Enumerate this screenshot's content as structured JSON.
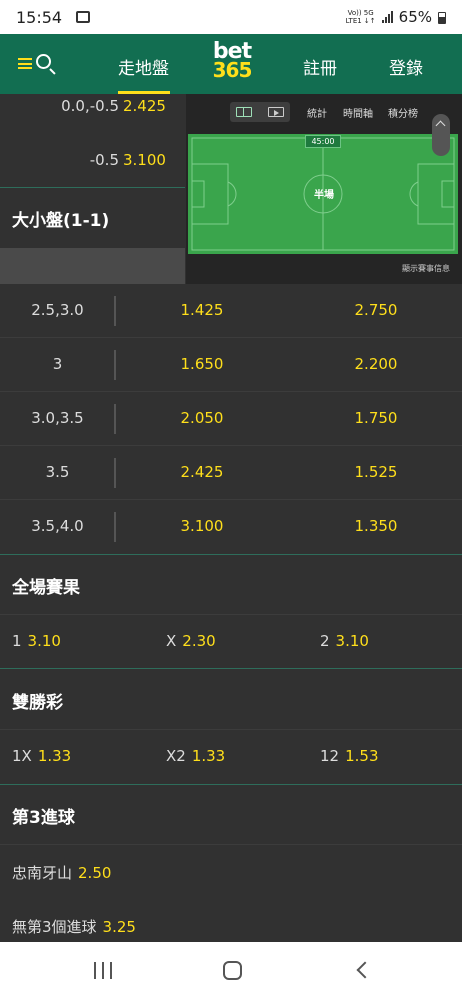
{
  "status_bar": {
    "time": "15:54",
    "network_top": "Vo)) 5G",
    "network_bottom": "LTE1 ↓↑",
    "battery": "65%"
  },
  "header": {
    "tabs": [
      {
        "label": "走地盤",
        "active": true
      },
      {
        "label": "註冊"
      },
      {
        "label": "登錄"
      }
    ],
    "logo_top": "bet",
    "logo_bottom": "365",
    "brand_color": "#126e51",
    "accent_color": "#ffdf1b"
  },
  "handicap": [
    {
      "line": "0.0,-0.5",
      "odds": "2.425"
    },
    {
      "line": "-0.5",
      "odds": "3.100"
    }
  ],
  "match_panel": {
    "tabs": [
      "統計",
      "時間軸",
      "積分榜"
    ],
    "clock": "45:00",
    "period": "半場",
    "info_link": "顯示賽事信息"
  },
  "over_under": {
    "title": "大小盤(1-1)",
    "rows": [
      {
        "line": "2.5,3.0",
        "over": "1.425",
        "under": "2.750"
      },
      {
        "line": "3",
        "over": "1.650",
        "under": "2.200"
      },
      {
        "line": "3.0,3.5",
        "over": "2.050",
        "under": "1.750"
      },
      {
        "line": "3.5",
        "over": "2.425",
        "under": "1.525"
      },
      {
        "line": "3.5,4.0",
        "over": "3.100",
        "under": "1.350"
      }
    ]
  },
  "full_time_result": {
    "title": "全場賽果",
    "selections": [
      {
        "name": "1",
        "odds": "3.10"
      },
      {
        "name": "X",
        "odds": "2.30"
      },
      {
        "name": "2",
        "odds": "3.10"
      }
    ]
  },
  "double_chance": {
    "title": "雙勝彩",
    "selections": [
      {
        "name": "1X",
        "odds": "1.33"
      },
      {
        "name": "X2",
        "odds": "1.33"
      },
      {
        "name": "12",
        "odds": "1.53"
      }
    ]
  },
  "third_goal": {
    "title": "第3進球",
    "selections": [
      {
        "name": "忠南牙山",
        "odds": "2.50"
      },
      {
        "name": "無第3個進球",
        "odds": "3.25"
      }
    ]
  }
}
